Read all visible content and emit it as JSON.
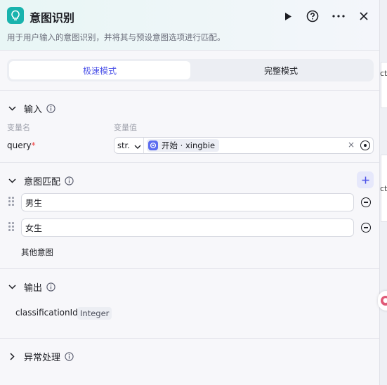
{
  "node": {
    "title": "意图识别",
    "description": "用于用户输入的意图识别，并将其与预设意图选项进行匹配。"
  },
  "header_actions": {
    "run_icon": "play-icon",
    "help_icon": "question-circle-icon",
    "more_icon": "more-horizontal-icon",
    "close_icon": "close-icon"
  },
  "mode": {
    "tabs": [
      "极速模式",
      "完整模式"
    ],
    "active": "极速模式"
  },
  "input_section": {
    "title": "输入",
    "col_name": "变量名",
    "col_value": "变量值",
    "variables": [
      {
        "name": "query",
        "required_mark": "*",
        "type": "str.",
        "reference": "开始 · xingbie"
      }
    ]
  },
  "intent_section": {
    "title": "意图匹配",
    "intents": [
      "男生",
      "女生"
    ],
    "other_intent": "其他意图"
  },
  "output_section": {
    "title": "输出",
    "outputs": [
      {
        "name": "classificationId",
        "type": "Integer"
      }
    ]
  },
  "error_section": {
    "title": "异常处理"
  },
  "canvas_edge": {
    "label_1": "ct",
    "label_2": "ct"
  },
  "colors": {
    "accent": "#4d53e8",
    "node_icon_bg": "#19b3ad",
    "required": "#ef4444"
  }
}
